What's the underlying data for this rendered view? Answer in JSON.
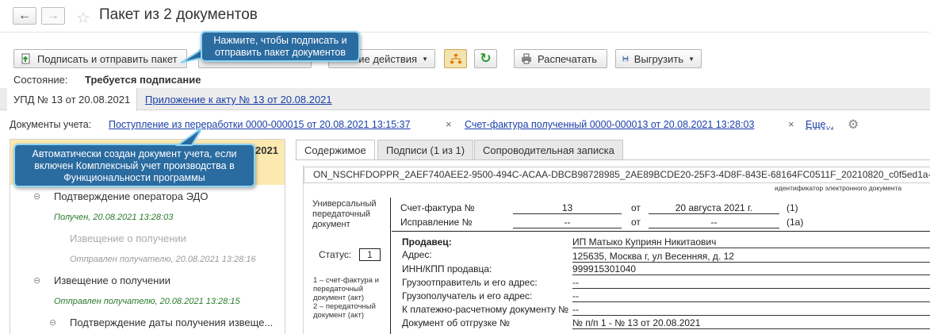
{
  "window": {
    "title": "Пакет из 2 документов"
  },
  "toolbar": {
    "sign_send": "Подписать и отправить пакет",
    "other_actions": "ие действия",
    "print": "Распечатать",
    "export": "Выгрузить"
  },
  "callouts": {
    "sign_hint": "Нажмите, чтобы подписать и отправить пакет документов",
    "auto_hint": "Автоматически создан документ учета, если включен Комплексный учет производства в Функциональности программы"
  },
  "status": {
    "label": "Состояние:",
    "value": "Требуется подписание"
  },
  "doc_tabs": {
    "active": "УПД № 13 от 20.08.2021",
    "link": "Приложение к акту № 13 от 20.08.2021"
  },
  "accounting": {
    "label": "Документы учета:",
    "doc1": "Поступление из переработки 0000-000015 от 20.08.2021 13:15:37",
    "doc2": "Счет-фактура полученный 0000-000013 от 20.08.2021 13:28:03",
    "more": "Еще...",
    "remove": "×"
  },
  "tree": {
    "header_fragment": "2021",
    "items": [
      {
        "title": "Подтверждение оператора ЭДО",
        "status": "Получен, 20.08.2021 13:28:03"
      },
      {
        "title": "Извещение о получении",
        "status": "Отправлен получателю, 20.08.2021 13:28:16"
      },
      {
        "title": "Извещение о получении",
        "status": "Отправлен получателю, 20.08.2021 13:28:15"
      },
      {
        "title": "Подтверждение даты получения извеще..."
      }
    ]
  },
  "right_tabs": [
    "Содержимое",
    "Подписи (1 из 1)",
    "Сопроводительная записка"
  ],
  "document": {
    "file_id": "ON_NSCHFDOPPR_2AEF740AEE2-9500-494C-ACAA-DBCB98728985_2AE89BCDE20-25F3-4D8F-843E-68164FC0511F_20210820_c0f5ed1a-dfe",
    "file_id_caption": "идентификатор электронного документа",
    "upd_title": "Универсальный передаточный документ",
    "status_label": "Статус:",
    "status_value": "1",
    "status_note": "1 – счет-фактура и передаточный документ (акт)\n2 – передаточный документ (акт)",
    "invoice_label": "Счет-фактура №",
    "invoice_no": "13",
    "from1": "от",
    "invoice_date": "20 августа 2021 г.",
    "code1": "(1)",
    "correction_label": "Исправление №",
    "correction_no": "--",
    "from2": "от",
    "correction_date": "--",
    "code1a": "(1а)",
    "seller_label": "Продавец:",
    "seller_value": "ИП Матыко Куприян Никитаович",
    "address_label": "Адрес:",
    "address_value": "125635, Москва г, ул Весенняя, д. 12",
    "inn_label": "ИНН/КПП продавца:",
    "inn_value": "999915301040",
    "shipper_label": "Грузоотправитель и его адрес:",
    "shipper_value": "--",
    "consignee_label": "Грузополучатель и его адрес:",
    "consignee_value": "--",
    "payment_label": "К платежно-расчетному документу №",
    "payment_value": "--",
    "shipment_label": "Документ об отгрузке №",
    "shipment_value": "№ п/п 1 - № 13 от 20.08.2021"
  }
}
